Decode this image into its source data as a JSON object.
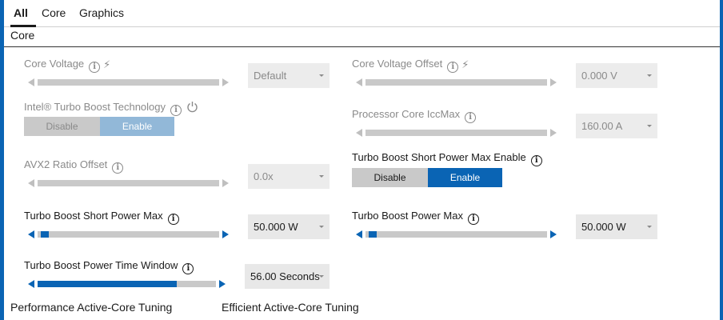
{
  "tabs": [
    "All",
    "Core",
    "Graphics"
  ],
  "section_title": "Core",
  "left": {
    "core_voltage": {
      "label": "Core Voltage",
      "dropdown": "Default",
      "slider_fraction": 0.0
    },
    "turbo_boost_tech": {
      "label": "Intel® Turbo Boost Technology",
      "off": "Disable",
      "on": "Enable",
      "selected": "Enable"
    },
    "avx2": {
      "label": "AVX2 Ratio Offset",
      "dropdown": "0.0x",
      "slider_fraction": 0.0
    },
    "short_power_max": {
      "label": "Turbo Boost Short Power Max",
      "dropdown": "50.000 W",
      "slider_fraction": 0.02
    },
    "time_window": {
      "label": "Turbo Boost Power Time Window",
      "dropdown": "56.00 Seconds",
      "slider_fraction": 0.78
    }
  },
  "right": {
    "core_voltage_offset": {
      "label": "Core Voltage Offset",
      "dropdown": "0.000 V",
      "slider_fraction": 0.0
    },
    "iccmax": {
      "label": "Processor Core IccMax",
      "dropdown": "160.00 A",
      "slider_fraction": 0.0
    },
    "short_power_enable": {
      "label": "Turbo Boost Short Power Max Enable",
      "off": "Disable",
      "on": "Enable",
      "selected": "Enable"
    },
    "power_max": {
      "label": "Turbo Boost Power Max",
      "dropdown": "50.000 W",
      "slider_fraction": 0.02
    }
  },
  "footer": {
    "performance": "Performance Active-Core Tuning",
    "efficient": "Efficient Active-Core Tuning"
  },
  "colors": {
    "accent": "#0a64b4",
    "track": "#c9c9c9",
    "disabled_text": "#8a8a8a"
  }
}
